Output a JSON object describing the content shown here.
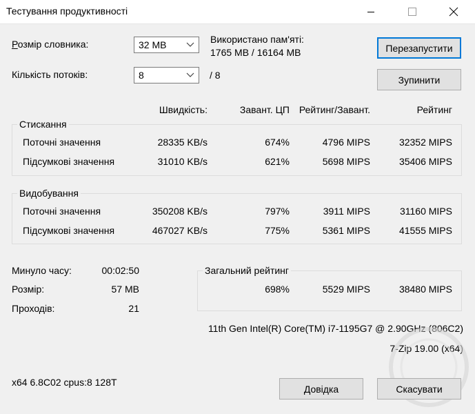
{
  "window": {
    "title": "Тестування продуктивності"
  },
  "dictionary": {
    "label_u": "Р",
    "label_rest": "озмір словника:",
    "value": "32 MB"
  },
  "threads": {
    "label": "Кількість потоків:",
    "value": "8",
    "max": "/ 8"
  },
  "memory": {
    "label": "Використано пам'яті:",
    "value": "1765 MB / 16164 MB"
  },
  "buttons": {
    "restart": "Перезапустити",
    "stop": "Зупинити",
    "help": "Довідка",
    "cancel": "Скасувати"
  },
  "headers": {
    "speed": "Швидкість:",
    "cpu": "Завант. ЦП",
    "rating_per_load": "Рейтинг/Завант.",
    "rating": "Рейтинг"
  },
  "compression": {
    "title": "Стискання",
    "rows": [
      {
        "label": "Поточні значення",
        "speed": "28335 KB/s",
        "cpu": "674%",
        "rpl": "4796 MIPS",
        "rating": "32352 MIPS"
      },
      {
        "label": "Підсумкові значення",
        "speed": "31010 KB/s",
        "cpu": "621%",
        "rpl": "5698 MIPS",
        "rating": "35406 MIPS"
      }
    ]
  },
  "decompression": {
    "title": "Видобування",
    "rows": [
      {
        "label": "Поточні значення",
        "speed": "350208 KB/s",
        "cpu": "797%",
        "rpl": "3911 MIPS",
        "rating": "31160 MIPS"
      },
      {
        "label": "Підсумкові значення",
        "speed": "467027 KB/s",
        "cpu": "775%",
        "rpl": "5361 MIPS",
        "rating": "41555 MIPS"
      }
    ]
  },
  "stats": {
    "elapsed_label": "Минуло часу:",
    "elapsed_value": "00:02:50",
    "size_label": "Розмір:",
    "size_value": "57 MB",
    "passes_label": "Проходів:",
    "passes_value": "21"
  },
  "total": {
    "title": "Загальний рейтинг",
    "cpu": "698%",
    "rpl": "5529 MIPS",
    "rating": "38480 MIPS"
  },
  "cpu_info": "11th Gen Intel(R) Core(TM) i7-1195G7 @ 2.90GHz (806C2)",
  "version": "7-Zip 19.00 (x64)",
  "sysinfo": "x64 6.8C02 cpus:8 128T",
  "colors": {
    "titlebar": "#ffffff",
    "window_bg": "#f0f0f0",
    "default_button_border": "#0078d7"
  }
}
